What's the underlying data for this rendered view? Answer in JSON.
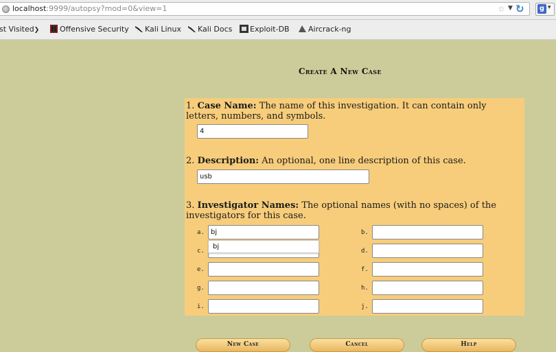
{
  "browser": {
    "url_host": "localhost",
    "url_rest": ":9999/autopsy?mod=0&view=1",
    "search_engine_icon": "google-icon"
  },
  "bookmarks": [
    {
      "label": "st Visited",
      "icon": "chevron-down-icon"
    },
    {
      "label": "Offensive Security",
      "icon": "offsec-icon"
    },
    {
      "label": "Kali Linux",
      "icon": "kali-icon"
    },
    {
      "label": "Kali Docs",
      "icon": "kali-icon"
    },
    {
      "label": "Exploit-DB",
      "icon": "exploitdb-icon"
    },
    {
      "label": "Aircrack-ng",
      "icon": "aircrack-icon"
    }
  ],
  "page": {
    "title": "Create A New Case",
    "case_name": {
      "number": "1.",
      "label": "Case Name:",
      "desc_line1": " The name of this investigation. It can contain only",
      "desc_line2": "letters, numbers, and symbols.",
      "value": "4"
    },
    "description": {
      "number": "2.",
      "label": "Description:",
      "desc": " An optional, one line description of this case.",
      "value": "usb"
    },
    "investigators": {
      "number": "3.",
      "label": "Investigator Names:",
      "desc_line1": " The optional names (with no spaces) of the",
      "desc_line2": "investigators for this case.",
      "fields": [
        {
          "label": "a.",
          "value": "bj"
        },
        {
          "label": "b.",
          "value": ""
        },
        {
          "label": "c.",
          "value": ""
        },
        {
          "label": "d.",
          "value": ""
        },
        {
          "label": "e.",
          "value": ""
        },
        {
          "label": "f.",
          "value": ""
        },
        {
          "label": "g.",
          "value": ""
        },
        {
          "label": "h.",
          "value": ""
        },
        {
          "label": "i.",
          "value": ""
        },
        {
          "label": "j.",
          "value": ""
        }
      ],
      "autocomplete_suggestion": "bj"
    },
    "buttons": {
      "new_case": "New Case",
      "cancel": "Cancel",
      "help": "Help"
    }
  },
  "colors": {
    "page_bg": "#cccc9a",
    "panel_bg": "#f7cd7b",
    "button_bg": "#f0c46c"
  }
}
